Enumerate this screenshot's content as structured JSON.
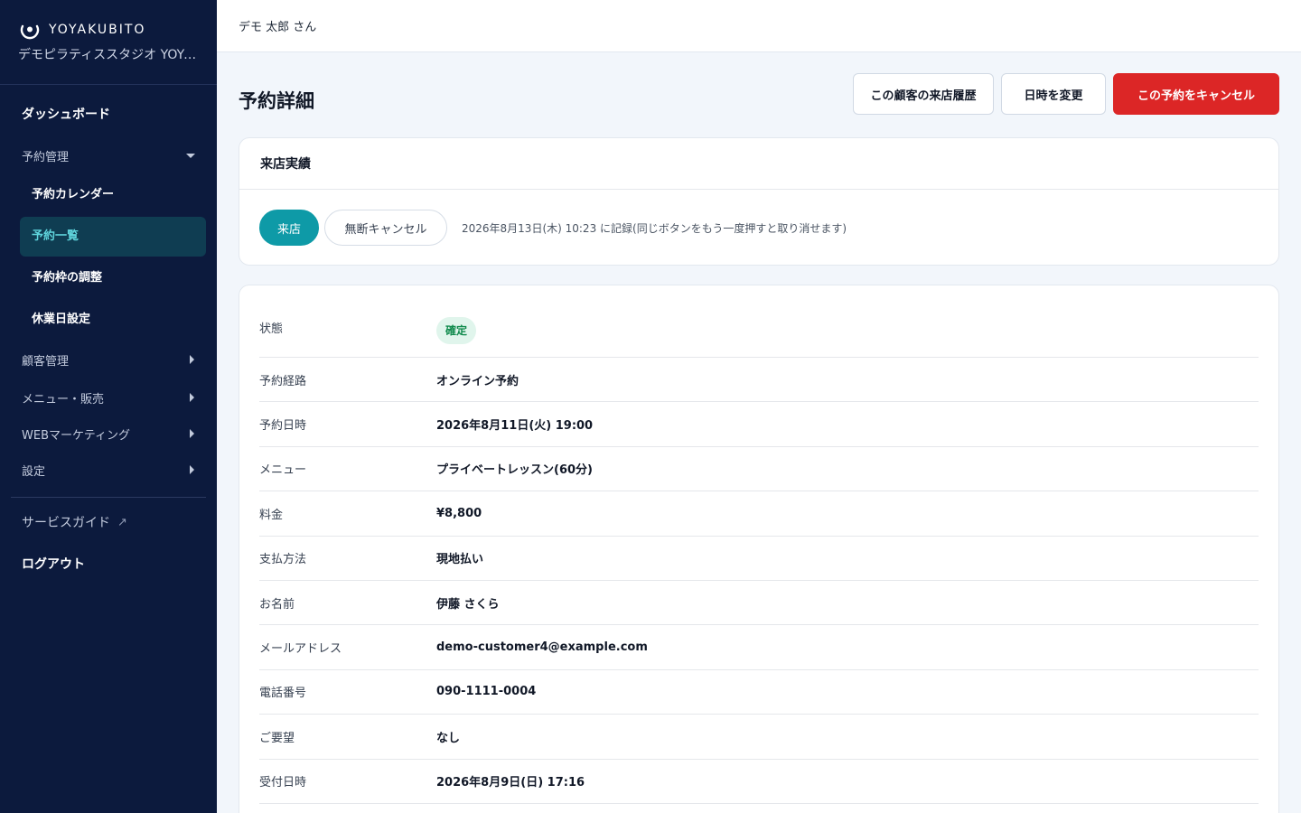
{
  "brand": {
    "name": "YOYAKUBITO",
    "shop_name": "デモピラティススタジオ YOYAKUBITO"
  },
  "sidebar": {
    "dashboard": "ダッシュボード",
    "reservation_group": "予約管理",
    "reservation_items": [
      "予約カレンダー",
      "予約一覧",
      "予約枠の調整",
      "休業日設定"
    ],
    "active_item": "予約一覧",
    "customer_group": "顧客管理",
    "menu_group": "メニュー・販売",
    "web_group": "WEBマーケティング",
    "settings_group": "設定",
    "guide": "サービスガイド",
    "logout": "ログアウト"
  },
  "header": {
    "user": "デモ 太郎 さん"
  },
  "page": {
    "title": "予約詳細",
    "actions": {
      "history": "この顧客の来店履歴",
      "change": "日時を変更",
      "cancel": "この予約をキャンセル"
    }
  },
  "visit": {
    "title": "来店実績",
    "visited": "来店",
    "no_show": "無断キャンセル",
    "note": "2026年8月13日(木) 10:23 に記録(同じボタンをもう一度押すと取り消せます)"
  },
  "details": {
    "status_label": "状態",
    "status_value": "確定",
    "rows": [
      {
        "label": "予約経路",
        "value": "オンライン予約"
      },
      {
        "label": "予約日時",
        "value": "2026年8月11日(火) 19:00"
      },
      {
        "label": "メニュー",
        "value": "プライベートレッスン(60分)"
      },
      {
        "label": "料金",
        "value": "¥8,800"
      },
      {
        "label": "支払方法",
        "value": "現地払い"
      },
      {
        "label": "お名前",
        "value": "伊藤 さくら"
      },
      {
        "label": "メールアドレス",
        "value": "demo-customer4@example.com"
      },
      {
        "label": "電話番号",
        "value": "090-1111-0004"
      },
      {
        "label": "ご要望",
        "value": "なし"
      },
      {
        "label": "受付日時",
        "value": "2026年8月9日(日) 17:16"
      }
    ]
  },
  "colors": {
    "sidebar_bg": "#0c1a3d",
    "active_item_bg": "#0f3d52",
    "active_item_text": "#5fd4dc",
    "teal": "#0e9aa7",
    "danger": "#dc2626",
    "badge_bg": "#e0f5ec",
    "badge_text": "#0f8a4c"
  }
}
